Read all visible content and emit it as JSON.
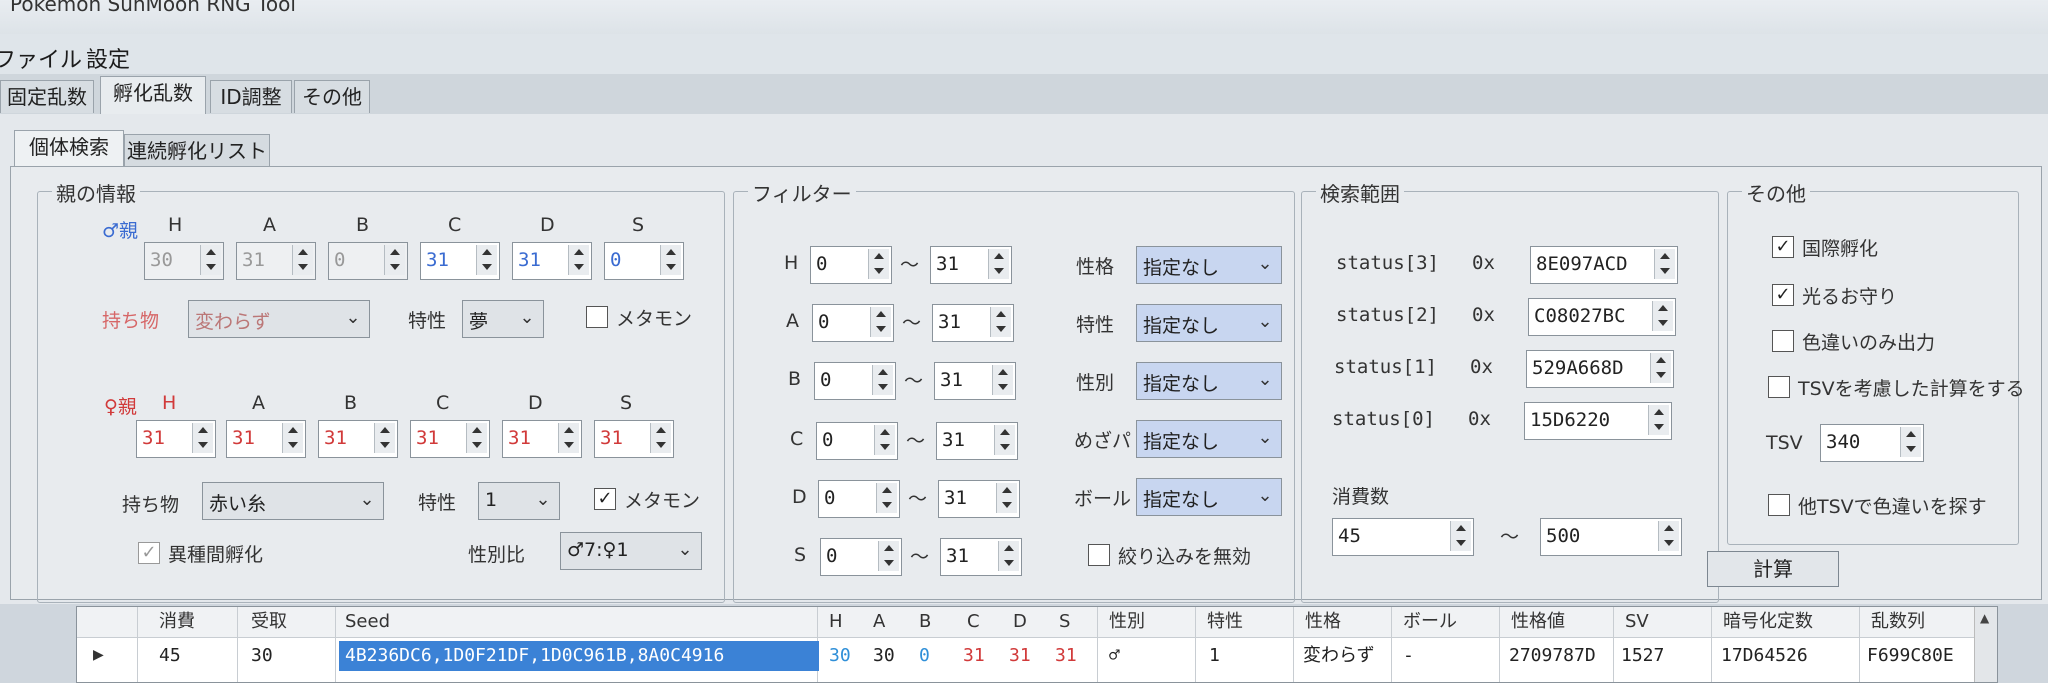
{
  "window": {
    "title": "Pokemon SunMoon RNG Tool"
  },
  "menu": [
    "ファイル",
    "設定"
  ],
  "tabs": [
    "固定乱数",
    "孵化乱数",
    "ID調整",
    "その他"
  ],
  "subtabs": [
    "個体検索",
    "連続孵化リスト"
  ],
  "parents": {
    "title": "親の情報",
    "stat_headers": [
      "H",
      "A",
      "B",
      "C",
      "D",
      "S"
    ],
    "male": {
      "label": "♂親",
      "ivs": [
        "30",
        "31",
        "0",
        "31",
        "31",
        "0"
      ],
      "item_label": "持ち物",
      "item": "変わらず",
      "ability_label": "特性",
      "ability": "夢",
      "ditto_label": "メタモン",
      "ditto_checked": false
    },
    "female": {
      "label": "♀親",
      "ivs": [
        "31",
        "31",
        "31",
        "31",
        "31",
        "31"
      ],
      "item_label": "持ち物",
      "item": "赤い糸",
      "ability_label": "特性",
      "ability": "1",
      "ditto_label": "メタモン",
      "ditto_checked": true
    },
    "cross_species_label": "異種間孵化",
    "cross_species_checked": true,
    "gender_ratio_label": "性別比",
    "gender_ratio": "♂7:♀1"
  },
  "filter": {
    "title": "フィルター",
    "rows": [
      {
        "stat": "H",
        "min": "0",
        "max": "31"
      },
      {
        "stat": "A",
        "min": "0",
        "max": "31"
      },
      {
        "stat": "B",
        "min": "0",
        "max": "31"
      },
      {
        "stat": "C",
        "min": "0",
        "max": "31"
      },
      {
        "stat": "D",
        "min": "0",
        "max": "31"
      },
      {
        "stat": "S",
        "min": "0",
        "max": "31"
      }
    ],
    "tilde": "～",
    "options": [
      {
        "label": "性格",
        "value": "指定なし"
      },
      {
        "label": "特性",
        "value": "指定なし"
      },
      {
        "label": "性別",
        "value": "指定なし"
      },
      {
        "label": "めざパ",
        "value": "指定なし"
      },
      {
        "label": "ボール",
        "value": "指定なし"
      }
    ],
    "disable_label": "絞り込みを無効",
    "disable_checked": false
  },
  "search_range": {
    "title": "検索範囲",
    "prefix": "0x",
    "status": [
      {
        "label": "status[3]",
        "value": "8E097ACD"
      },
      {
        "label": "status[2]",
        "value": "C08027BC"
      },
      {
        "label": "status[1]",
        "value": "529A668D"
      },
      {
        "label": "status[0]",
        "value": "15D6220"
      }
    ],
    "consumption_label": "消費数",
    "min": "45",
    "max": "500",
    "tilde": "～"
  },
  "other": {
    "title": "その他",
    "checks": [
      {
        "label": "国際孵化",
        "checked": true
      },
      {
        "label": "光るお守り",
        "checked": true
      },
      {
        "label": "色違いのみ出力",
        "checked": false
      },
      {
        "label": "TSVを考慮した計算をする",
        "checked": false
      }
    ],
    "tsv_label": "TSV",
    "tsv": "340",
    "other_tsv_label": "他TSVで色違いを探す",
    "other_tsv_checked": false
  },
  "calc_button": "計算",
  "results": {
    "headers": [
      "消費",
      "受取",
      "Seed",
      "H",
      "A",
      "B",
      "C",
      "D",
      "S",
      "性別",
      "特性",
      "性格",
      "ボール",
      "性格値",
      "SV",
      "暗号化定数",
      "乱数列"
    ],
    "row": [
      "45",
      "30",
      "4B236DC6,1D0F21DF,1D0C961B,8A0C4916",
      "30",
      "30",
      "0",
      "31",
      "31",
      "31",
      "♂",
      "1",
      "変わらず",
      "-",
      "2709787D",
      "1527",
      "17D64526",
      "F699C80E"
    ],
    "colors": {
      "selected": "#3b82d6",
      "red": "#d13a3a",
      "blue": "#2f8fd8"
    }
  }
}
